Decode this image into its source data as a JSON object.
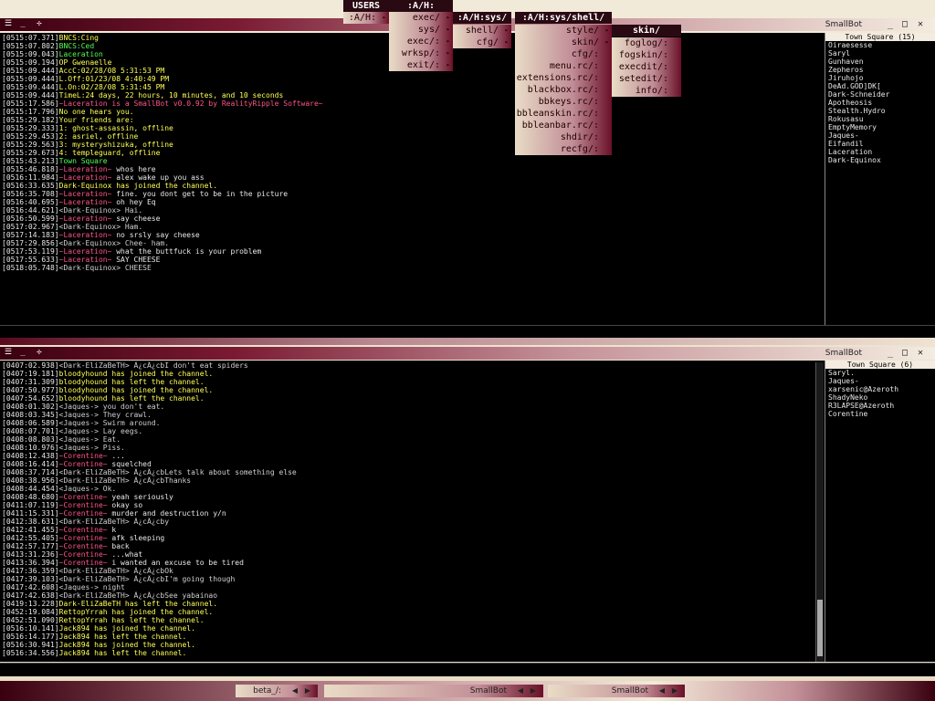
{
  "colors": {
    "ts": "#e8e8e8",
    "bncs": "#ffff55",
    "green": "#55ff55",
    "yellow": "#ffff55",
    "pink": "#ff5588",
    "white": "#e8e8e8",
    "gray": "#cfcfcf"
  },
  "top_window": {
    "title": "SmallBot",
    "userlist_header": "Town Square (15)",
    "users": [
      "Oiraesesse",
      "Saryl",
      "Gunhaven",
      "Zepheros",
      "Jiruhojo",
      "DeAd.GOD]DK[",
      "Dark-Schneider",
      "Apotheosis",
      "Stealth.Hydro",
      "Rokusasu",
      "EmptyMemory",
      "Jaques-",
      "Eifandil",
      "Laceration",
      "Dark-Equinox"
    ],
    "lines": [
      {
        "t": "[0515:07.371]",
        "parts": [
          {
            "c": "yellow",
            "x": "BNCS:Cing"
          }
        ]
      },
      {
        "t": "[0515:07.802]",
        "parts": [
          {
            "c": "green",
            "x": "BNCS:Ced"
          }
        ]
      },
      {
        "t": "[0515:09.043]",
        "parts": [
          {
            "c": "green",
            "x": "Laceration"
          }
        ]
      },
      {
        "t": "[0515:09.194]",
        "parts": [
          {
            "c": "yellow",
            "x": "OP Gwenaelle"
          }
        ]
      },
      {
        "t": "[0515:09.444]",
        "parts": [
          {
            "c": "yellow",
            "x": "AccC:02/28/08 5:31:53 PM"
          }
        ]
      },
      {
        "t": "[0515:09.444]",
        "parts": [
          {
            "c": "yellow",
            "x": "L.Off:01/23/08 4:40:49 PM"
          }
        ]
      },
      {
        "t": "[0515:09.444]",
        "parts": [
          {
            "c": "yellow",
            "x": "L.On:02/28/08 5:31:45 PM"
          }
        ]
      },
      {
        "t": "[0515:09.444]",
        "parts": [
          {
            "c": "yellow",
            "x": "TimeL:24 days, 22 hours, 10 minutes, and 10 seconds"
          }
        ]
      },
      {
        "t": "[0515:17.586]",
        "parts": [
          {
            "c": "pink",
            "x": "~Laceration is a SmallBot v0.0.92 by RealityRipple Software~"
          }
        ]
      },
      {
        "t": "[0515:17.796]",
        "parts": [
          {
            "c": "yellow",
            "x": "No one hears you."
          }
        ]
      },
      {
        "t": "[0515:29.182]",
        "parts": [
          {
            "c": "yellow",
            "x": "Your friends are:"
          }
        ]
      },
      {
        "t": "[0515:29.333]",
        "parts": [
          {
            "c": "yellow",
            "x": "1: ghost-assassin, offline"
          }
        ]
      },
      {
        "t": "[0515:29.453]",
        "parts": [
          {
            "c": "yellow",
            "x": "2: asriel, offline"
          }
        ]
      },
      {
        "t": "[0515:29.563]",
        "parts": [
          {
            "c": "yellow",
            "x": "3: mysteryshizuka, offline"
          }
        ]
      },
      {
        "t": "[0515:29.673]",
        "parts": [
          {
            "c": "yellow",
            "x": "4: templeguard, offline"
          }
        ]
      },
      {
        "t": "[0515:43.213]",
        "parts": [
          {
            "c": "green",
            "x": "Town Square"
          }
        ]
      },
      {
        "t": "[0515:46.818]",
        "parts": [
          {
            "c": "pink",
            "x": "~Laceration~"
          },
          {
            "c": "white",
            "x": " whos here"
          }
        ]
      },
      {
        "t": "[0516:11.984]",
        "parts": [
          {
            "c": "pink",
            "x": "~Laceration~"
          },
          {
            "c": "white",
            "x": " alex wake up you ass"
          }
        ]
      },
      {
        "t": "[0516:33.635]",
        "parts": [
          {
            "c": "yellow",
            "x": "Dark-Equinox has joined the channel."
          }
        ]
      },
      {
        "t": "[0516:35.708]",
        "parts": [
          {
            "c": "pink",
            "x": "~Laceration~"
          },
          {
            "c": "white",
            "x": " fine. you dont get to be in the picture"
          }
        ]
      },
      {
        "t": "[0516:40.695]",
        "parts": [
          {
            "c": "pink",
            "x": "~Laceration~"
          },
          {
            "c": "white",
            "x": " oh hey Eq"
          }
        ]
      },
      {
        "t": "[0516:44.621]",
        "parts": [
          {
            "c": "gray",
            "x": "<Dark-Equinox> Hai."
          }
        ]
      },
      {
        "t": "[0516:50.599]",
        "parts": [
          {
            "c": "pink",
            "x": "~Laceration~"
          },
          {
            "c": "white",
            "x": " say cheese"
          }
        ]
      },
      {
        "t": "[0517:02.967]",
        "parts": [
          {
            "c": "gray",
            "x": "<Dark-Equinox> Ham."
          }
        ]
      },
      {
        "t": "[0517:14.183]",
        "parts": [
          {
            "c": "pink",
            "x": "~Laceration~"
          },
          {
            "c": "white",
            "x": " no srsly say cheese"
          }
        ]
      },
      {
        "t": "[0517:29.856]",
        "parts": [
          {
            "c": "gray",
            "x": "<Dark-Equinox> Chee- ham."
          }
        ]
      },
      {
        "t": "[0517:53.119]",
        "parts": [
          {
            "c": "pink",
            "x": "~Laceration~"
          },
          {
            "c": "white",
            "x": " what the buttfuck is your problem"
          }
        ]
      },
      {
        "t": "[0517:55.633]",
        "parts": [
          {
            "c": "pink",
            "x": "~Laceration~"
          },
          {
            "c": "white",
            "x": " SAY CHEESE"
          }
        ]
      },
      {
        "t": "[0518:05.748]",
        "parts": [
          {
            "c": "gray",
            "x": "<Dark-Equinox> CHEESE"
          }
        ]
      }
    ]
  },
  "bottom_window": {
    "title": "SmallBot",
    "userlist_header": "Town Square (6)",
    "users": [
      "Saryl.",
      "Jaques-",
      "xarsenic@Azeroth",
      "ShadyNeko",
      "R3LAPSE@Azeroth",
      "Corentine"
    ],
    "lines": [
      {
        "t": "[0407:02.938]",
        "parts": [
          {
            "c": "gray",
            "x": "<Dark-EliZaBeTH> Â¿cÂ¿cbI don't eat spiders"
          }
        ]
      },
      {
        "t": "[0407:19.181]",
        "parts": [
          {
            "c": "yellow",
            "x": "bloodyhound has joined the channel."
          }
        ]
      },
      {
        "t": "[0407:31.309]",
        "parts": [
          {
            "c": "yellow",
            "x": "bloodyhound has left the channel."
          }
        ]
      },
      {
        "t": "[0407:50.977]",
        "parts": [
          {
            "c": "yellow",
            "x": "bloodyhound has joined the channel."
          }
        ]
      },
      {
        "t": "[0407:54.652]",
        "parts": [
          {
            "c": "yellow",
            "x": "bloodyhound has left the channel."
          }
        ]
      },
      {
        "t": "[0408:01.302]",
        "parts": [
          {
            "c": "gray",
            "x": "<Jaques-> you don't eat."
          }
        ]
      },
      {
        "t": "[0408:03.345]",
        "parts": [
          {
            "c": "gray",
            "x": "<Jaques-> They crawl."
          }
        ]
      },
      {
        "t": "[0408:06.589]",
        "parts": [
          {
            "c": "gray",
            "x": "<Jaques-> Swirm around."
          }
        ]
      },
      {
        "t": "[0408:07.701]",
        "parts": [
          {
            "c": "gray",
            "x": "<Jaques-> Lay eegs."
          }
        ]
      },
      {
        "t": "[0408:08.803]",
        "parts": [
          {
            "c": "gray",
            "x": "<Jaques-> Eat."
          }
        ]
      },
      {
        "t": "[0408:10.976]",
        "parts": [
          {
            "c": "gray",
            "x": "<Jaques-> Piss."
          }
        ]
      },
      {
        "t": "[0408:12.438]",
        "parts": [
          {
            "c": "pink",
            "x": "~Corentine~"
          },
          {
            "c": "white",
            "x": " ..."
          }
        ]
      },
      {
        "t": "[0408:16.414]",
        "parts": [
          {
            "c": "pink",
            "x": "~Corentine~"
          },
          {
            "c": "white",
            "x": " squelched"
          }
        ]
      },
      {
        "t": "[0408:37.714]",
        "parts": [
          {
            "c": "gray",
            "x": "<Dark-EliZaBeTH> Â¿cÂ¿cbLets talk about something else"
          }
        ]
      },
      {
        "t": "[0408:38.956]",
        "parts": [
          {
            "c": "gray",
            "x": "<Dark-EliZaBeTH> Â¿cÂ¿cbThanks"
          }
        ]
      },
      {
        "t": "[0408:44.454]",
        "parts": [
          {
            "c": "gray",
            "x": "<Jaques-> Ok."
          }
        ]
      },
      {
        "t": "[0408:48.680]",
        "parts": [
          {
            "c": "pink",
            "x": "~Corentine~"
          },
          {
            "c": "white",
            "x": " yeah seriously"
          }
        ]
      },
      {
        "t": "[0411:07.119]",
        "parts": [
          {
            "c": "pink",
            "x": "~Corentine~"
          },
          {
            "c": "white",
            "x": " okay so"
          }
        ]
      },
      {
        "t": "[0411:15.331]",
        "parts": [
          {
            "c": "pink",
            "x": "~Corentine~"
          },
          {
            "c": "white",
            "x": " murder and destruction y/n"
          }
        ]
      },
      {
        "t": "[0412:38.631]",
        "parts": [
          {
            "c": "gray",
            "x": "<Dark-EliZaBeTH> Â¿cÂ¿cby"
          }
        ]
      },
      {
        "t": "[0412:41.455]",
        "parts": [
          {
            "c": "pink",
            "x": "~Corentine~"
          },
          {
            "c": "white",
            "x": " k"
          }
        ]
      },
      {
        "t": "[0412:55.405]",
        "parts": [
          {
            "c": "pink",
            "x": "~Corentine~"
          },
          {
            "c": "white",
            "x": " afk sleeping"
          }
        ]
      },
      {
        "t": "[0412:57.177]",
        "parts": [
          {
            "c": "pink",
            "x": "~Corentine~"
          },
          {
            "c": "white",
            "x": " back"
          }
        ]
      },
      {
        "t": "[0413:31.236]",
        "parts": [
          {
            "c": "pink",
            "x": "~Corentine~"
          },
          {
            "c": "white",
            "x": " ...what"
          }
        ]
      },
      {
        "t": "[0413:36.394]",
        "parts": [
          {
            "c": "pink",
            "x": "~Corentine~"
          },
          {
            "c": "white",
            "x": " i wanted an excuse to be tired"
          }
        ]
      },
      {
        "t": "[0417:36.359]",
        "parts": [
          {
            "c": "gray",
            "x": "<Dark-EliZaBeTH> Â¿cÂ¿cbOk"
          }
        ]
      },
      {
        "t": "[0417:39.103]",
        "parts": [
          {
            "c": "gray",
            "x": "<Dark-EliZaBeTH> Â¿cÂ¿cbI'm going though"
          }
        ]
      },
      {
        "t": "[0417:42.608]",
        "parts": [
          {
            "c": "gray",
            "x": "<Jaques-> night"
          }
        ]
      },
      {
        "t": "[0417:42.638]",
        "parts": [
          {
            "c": "gray",
            "x": "<Dark-EliZaBeTH> Â¿cÂ¿cbSee yabainao"
          }
        ]
      },
      {
        "t": "[0419:13.228]",
        "parts": [
          {
            "c": "yellow",
            "x": "Dark-EliZaBeTH has left the channel."
          }
        ]
      },
      {
        "t": "[0452:19.084]",
        "parts": [
          {
            "c": "yellow",
            "x": "RettopYrrah has joined the channel."
          }
        ]
      },
      {
        "t": "[0452:51.090]",
        "parts": [
          {
            "c": "yellow",
            "x": "RettopYrrah has left the channel."
          }
        ]
      },
      {
        "t": "[0516:10.141]",
        "parts": [
          {
            "c": "yellow",
            "x": "Jack894 has joined the channel."
          }
        ]
      },
      {
        "t": "[0516:14.177]",
        "parts": [
          {
            "c": "yellow",
            "x": "Jack894 has left the channel."
          }
        ]
      },
      {
        "t": "[0516:30.941]",
        "parts": [
          {
            "c": "yellow",
            "x": "Jack894 has joined the channel."
          }
        ]
      },
      {
        "t": "[0516:34.556]",
        "parts": [
          {
            "c": "yellow",
            "x": "Jack894 has left the channel."
          }
        ]
      }
    ]
  },
  "menus": {
    "users_label": "USERS",
    "root_label": ":A/H:",
    "root_item": ":A/H:",
    "ah_items": [
      "exec/",
      "sys/",
      "exec/:",
      "wrksp/:",
      "exit/:"
    ],
    "sys_header": ":A/H:sys/",
    "sys_items": [
      "shell/",
      "cfg/"
    ],
    "shell_header": ":A/H:sys/shell/",
    "shell_items": [
      "style/",
      "skin/",
      "cfg/:",
      "menu.rc/:",
      "extensions.rc/:",
      "blackbox.rc/:",
      "bbkeys.rc/:",
      "bbleanskin.rc/:",
      "bbleanbar.rc/:",
      "shdir/:",
      "recfg/:"
    ],
    "skin_header": "skin/",
    "skin_items": [
      "foglog/:",
      "fogskin/:",
      "execdit/:",
      "setedit/:",
      "info/:"
    ]
  },
  "taskbar": {
    "items": [
      "beta_/:",
      "SmallBot",
      "SmallBot"
    ]
  }
}
